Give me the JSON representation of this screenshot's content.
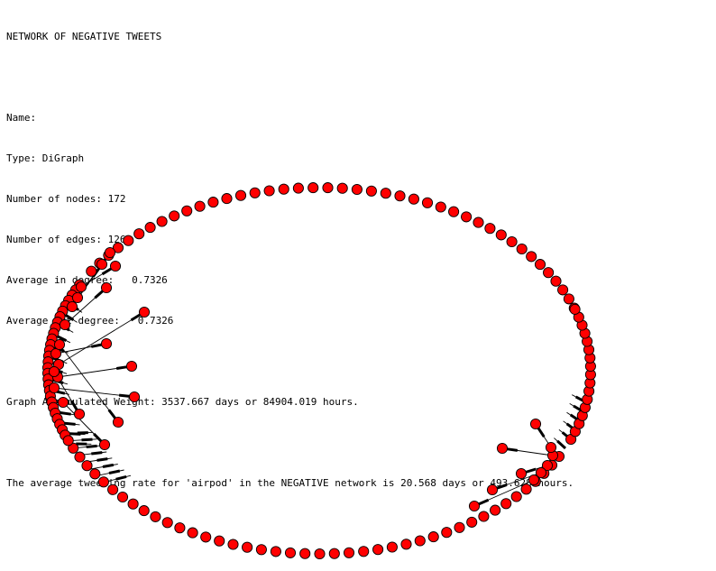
{
  "report": {
    "title": "NETWORK OF NEGATIVE TWEETS",
    "name_line": "Name:",
    "type_line": "Type: DiGraph",
    "nodes_line": "Number of nodes: 172",
    "edges_line": "Number of edges: 126",
    "in_degree_line": "Average in degree:   0.7326",
    "out_degree_line": "Average out degree:   0.7326",
    "weight_line": "Graph Accmmulated Weight: 3537.667 days or 84904.019 hours.",
    "rate_line": "The average tweeting rate for 'airpod' in the NEGATIVE network is 20.568 days or 493.628 hours."
  },
  "graph": {
    "node_fill": "#ff0000",
    "node_stroke": "#000000",
    "edge_color": "#000000"
  }
}
